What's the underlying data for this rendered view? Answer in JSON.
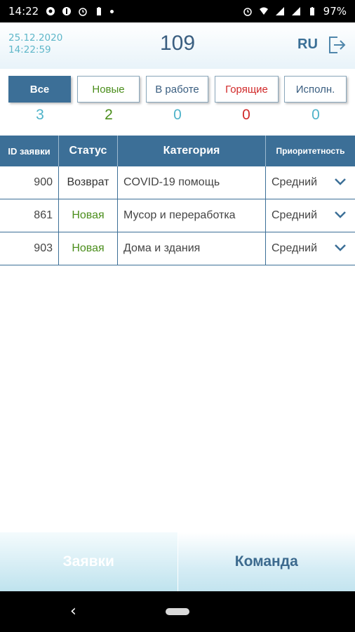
{
  "status_bar": {
    "time": "14:22",
    "battery": "97%"
  },
  "header": {
    "date": "25.12.2020",
    "time": "14:22:59",
    "number": "109",
    "lang": "RU"
  },
  "filters": [
    {
      "label": "Все",
      "count": "3",
      "color": "#ffffff",
      "count_color": "#4fb3c9"
    },
    {
      "label": "Новые",
      "count": "2",
      "color": "#4b8e1c",
      "count_color": "#4b8e1c"
    },
    {
      "label": "В работе",
      "count": "0",
      "color": "#3a5e80",
      "count_color": "#4fb3c9"
    },
    {
      "label": "Горящие",
      "count": "0",
      "color": "#d12a2a",
      "count_color": "#d12a2a"
    },
    {
      "label": "Исполн.",
      "count": "0",
      "color": "#3a5e80",
      "count_color": "#4fb3c9"
    }
  ],
  "table": {
    "headers": [
      "ID заявки",
      "Статус",
      "Категория",
      "Приоритетность"
    ],
    "rows": [
      {
        "id": "900",
        "status": "Возврат",
        "status_color": "#333333",
        "category": "COVID-19 помощь",
        "priority": "Средний"
      },
      {
        "id": "861",
        "status": "Новая",
        "status_color": "#4b8e1c",
        "category": "Мусор и переработка",
        "priority": "Средний"
      },
      {
        "id": "903",
        "status": "Новая",
        "status_color": "#4b8e1c",
        "category": "Дома и здания",
        "priority": "Средний"
      }
    ]
  },
  "tabs": {
    "requests": "Заявки",
    "team": "Команда"
  },
  "colors": {
    "accent": "#3c6f97",
    "header_text": "#3a5e80",
    "cyan": "#5fb7c9"
  },
  "icons": {
    "logout": "logout-icon",
    "chevron": "chevron-down-icon"
  }
}
